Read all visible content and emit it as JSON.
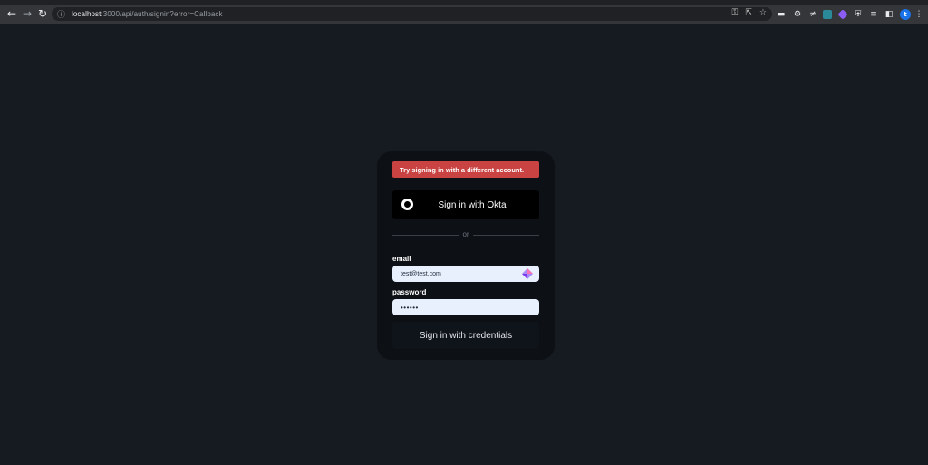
{
  "browser": {
    "url_host": "localhost",
    "url_path": ":3000/api/auth/signin?error=Callback",
    "profile_initial": "t"
  },
  "signin": {
    "error_message": "Try signing in with a different account.",
    "okta_button_label": "Sign in with Okta",
    "divider_text": "or",
    "email_label": "email",
    "email_value": "test@test.com",
    "password_label": "password",
    "password_value": "••••••",
    "credentials_button_label": "Sign in with credentials"
  },
  "colors": {
    "background": "#161a21",
    "card": "#0d1015",
    "error": "#c94343",
    "input": "#e8f0fe"
  }
}
